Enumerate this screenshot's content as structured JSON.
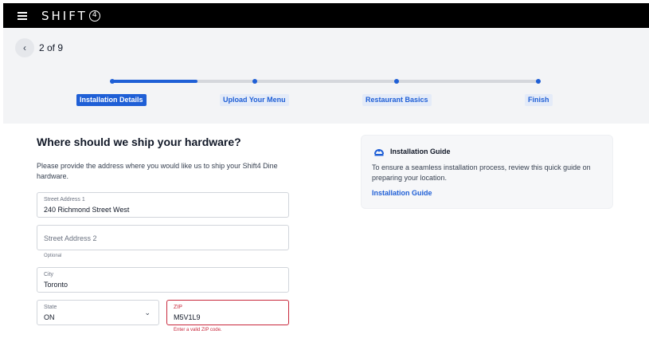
{
  "header": {
    "logo_text": "SHIFT",
    "logo_mark": "4",
    "menu_icon": "hamburger-menu-icon"
  },
  "progress": {
    "step_count": "2 of 9",
    "back_icon": "chevron-left-icon",
    "current_step_fraction": 0.6,
    "steps": [
      {
        "label": "Installation Details",
        "state": "active"
      },
      {
        "label": "Upload Your Menu",
        "state": "pending"
      },
      {
        "label": "Restaurant Basics",
        "state": "pending"
      },
      {
        "label": "Finish",
        "state": "pending"
      }
    ]
  },
  "form": {
    "title": "Where should we ship your hardware?",
    "description": "Please provide the address where you would like us to ship your Shift4 Dine hardware.",
    "street1": {
      "label": "Street Address 1",
      "value": "240 Richmond Street West"
    },
    "street2": {
      "placeholder": "Street Address 2",
      "helper": "Optional"
    },
    "city": {
      "label": "City",
      "value": "Toronto"
    },
    "state": {
      "label": "State",
      "value": "ON",
      "icon": "chevron-down-icon"
    },
    "zip": {
      "label": "ZIP",
      "value": "M5V1L9",
      "error": "Enter a valid ZIP code."
    }
  },
  "guide": {
    "icon": "installation-guide-icon",
    "title": "Installation Guide",
    "text": "To ensure a seamless installation process, review this quick guide on preparing your location.",
    "link": "Installation Guide"
  },
  "colors": {
    "accent": "#1f5fd6",
    "error": "#c8283c",
    "topbar": "#000000",
    "track": "#d5d7dc"
  }
}
